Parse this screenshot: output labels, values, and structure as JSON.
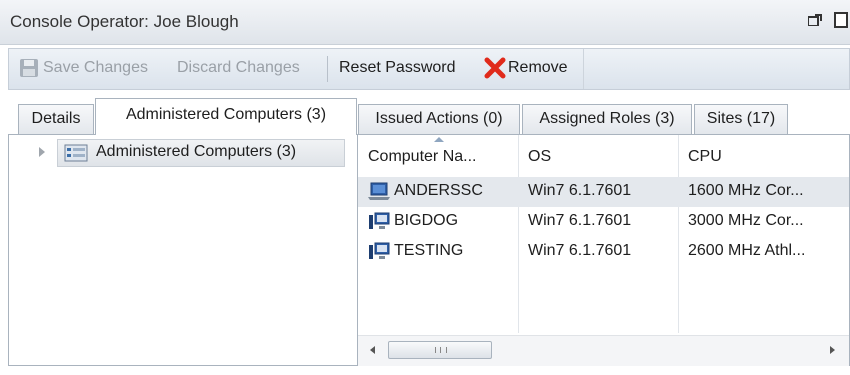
{
  "window": {
    "title": "Console Operator: Joe Blough",
    "icons": [
      "undock-icon",
      "window-icon"
    ]
  },
  "toolbar": {
    "save_label": "Save Changes",
    "discard_label": "Discard Changes",
    "reset_label": "Reset Password",
    "remove_label": "Remove",
    "save_enabled": false,
    "discard_enabled": false,
    "icons": {
      "save": "floppy-disk-icon",
      "remove": "red-x-icon"
    },
    "colors": {
      "remove_icon": "#e02a1b"
    }
  },
  "tabs": [
    {
      "label": "Details",
      "active": false
    },
    {
      "label": "Administered Computers (3)",
      "active": true
    },
    {
      "label": "Issued Actions (0)",
      "active": false
    },
    {
      "label": "Assigned Roles (3)",
      "active": false
    },
    {
      "label": "Sites (17)",
      "active": false
    }
  ],
  "tree": {
    "node_label": "Administered Computers (3)",
    "expanded": false,
    "icon": "computer-list-icon"
  },
  "grid": {
    "columns": [
      "Computer Na...",
      "OS",
      "CPU"
    ],
    "sort_column": "Computer Na...",
    "selected_row": 0,
    "rows": [
      {
        "name": "ANDERSSC",
        "os": "Win7 6.1.7601",
        "cpu": "1600 MHz Cor...",
        "icon": "laptop-icon"
      },
      {
        "name": "BIGDOG",
        "os": "Win7 6.1.7601",
        "cpu": "3000 MHz Cor...",
        "icon": "desktop-computer-icon"
      },
      {
        "name": "TESTING",
        "os": "Win7 6.1.7601",
        "cpu": "2600 MHz Athl...",
        "icon": "desktop-computer-icon"
      }
    ]
  }
}
